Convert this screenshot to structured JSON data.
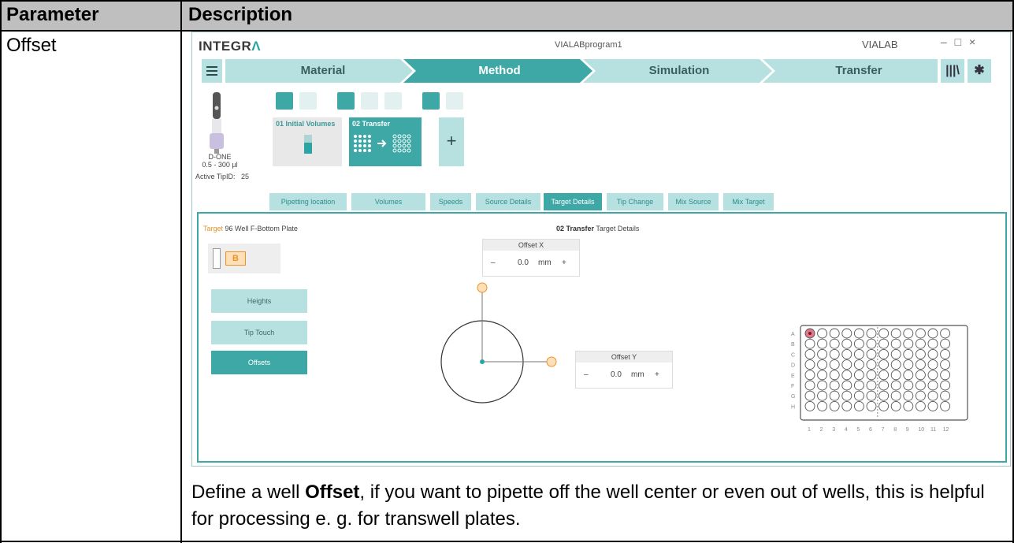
{
  "table": {
    "header_param": "Parameter",
    "header_desc": "Description",
    "param": "Offset",
    "desc_pre": "Define a well ",
    "desc_bold": "Offset",
    "desc_post": ", if you want to pipette off the well center or even out of wells, this is helpful for processing e. g. for transwell plates."
  },
  "app": {
    "logo": "INTEGRA",
    "window_title": "VIALABprogram1",
    "vialab": "VIALAB",
    "window_controls": "– □ ×",
    "nav_steps": [
      "Material",
      "Method",
      "Simulation",
      "Transfer"
    ],
    "active_step": "Method",
    "pipette": {
      "name": "D-ONE",
      "range": "0.5 - 300 µl",
      "tip_label": "Active TipID:",
      "tip_value": "25"
    },
    "cards": {
      "card1": "01 Initial Volumes",
      "card2": "02 Transfer",
      "add": "+"
    },
    "tabs": [
      "Pipetting location",
      "Volumes",
      "Speeds",
      "Source Details",
      "Target Details",
      "Tip Change",
      "Mix Source",
      "Mix Target"
    ],
    "active_tab": "Target Details",
    "panel": {
      "target_word": "Target",
      "target_plate": "96 Well F-Bottom Plate",
      "title_bold": "02 Transfer",
      "title_rest": "Target Details",
      "plate_letter": "B",
      "side_buttons": [
        "Heights",
        "Tip Touch",
        "Offsets"
      ],
      "active_side": "Offsets",
      "offset_x": {
        "title": "Offset X",
        "minus": "–",
        "value": "0.0",
        "unit": "mm",
        "plus": "+"
      },
      "offset_y": {
        "title": "Offset Y",
        "minus": "–",
        "value": "0.0",
        "unit": "mm",
        "plus": "+"
      }
    },
    "plate": {
      "rows": [
        "A",
        "B",
        "C",
        "D",
        "E",
        "F",
        "G",
        "H"
      ],
      "cols": [
        "1",
        "2",
        "3",
        "4",
        "5",
        "6",
        "7",
        "8",
        "9",
        "10",
        "11",
        "12"
      ],
      "selected_well": "A1",
      "selected_color": "#e07a8a"
    },
    "colors": {
      "teal": "#3ea8a6",
      "light_teal": "#b7e1e0",
      "orange": "#e8942a"
    }
  }
}
